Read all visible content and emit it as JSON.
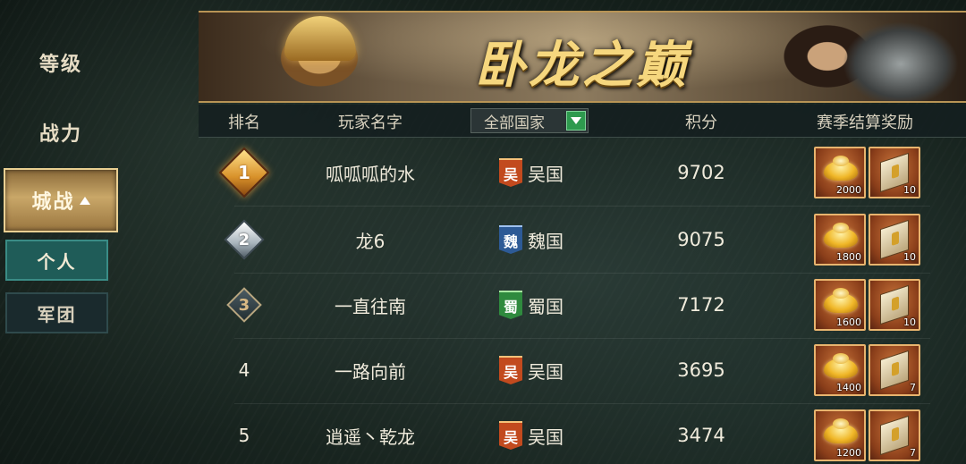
{
  "sidebar": {
    "items": [
      {
        "label": "等级"
      },
      {
        "label": "战力"
      },
      {
        "label": "城战"
      }
    ],
    "sub_items": [
      {
        "label": "个人"
      },
      {
        "label": "军团"
      }
    ]
  },
  "banner": {
    "title": "卧龙之巅"
  },
  "table": {
    "headers": {
      "rank": "排名",
      "name": "玩家名字",
      "country_filter": "全部国家",
      "score": "积分",
      "reward": "赛季结算奖励"
    },
    "rows": [
      {
        "rank": "1",
        "name": "呱呱呱的水",
        "country_tag": "吴",
        "country": "吴国",
        "score": "9702",
        "gold": "2000",
        "scroll": "10"
      },
      {
        "rank": "2",
        "name": "龙6",
        "country_tag": "魏",
        "country": "魏国",
        "score": "9075",
        "gold": "1800",
        "scroll": "10"
      },
      {
        "rank": "3",
        "name": "一直往南",
        "country_tag": "蜀",
        "country": "蜀国",
        "score": "7172",
        "gold": "1600",
        "scroll": "10"
      },
      {
        "rank": "4",
        "name": "一路向前",
        "country_tag": "吴",
        "country": "吴国",
        "score": "3695",
        "gold": "1400",
        "scroll": "7"
      },
      {
        "rank": "5",
        "name": "逍遥丶乾龙",
        "country_tag": "吴",
        "country": "吴国",
        "score": "3474",
        "gold": "1200",
        "scroll": "7"
      }
    ]
  },
  "colors": {
    "active_tab": "#c9a768",
    "sub_tab_active": "#1f5c58",
    "wu": "#c24a1e",
    "wei": "#2d5a96",
    "shu": "#2f8a3e",
    "title_gold": "#f6d77e"
  },
  "icons": [
    "caret-up-icon",
    "dropdown-arrow-icon",
    "gold-ingot-icon",
    "scroll-icon",
    "rank-badge-icon"
  ]
}
